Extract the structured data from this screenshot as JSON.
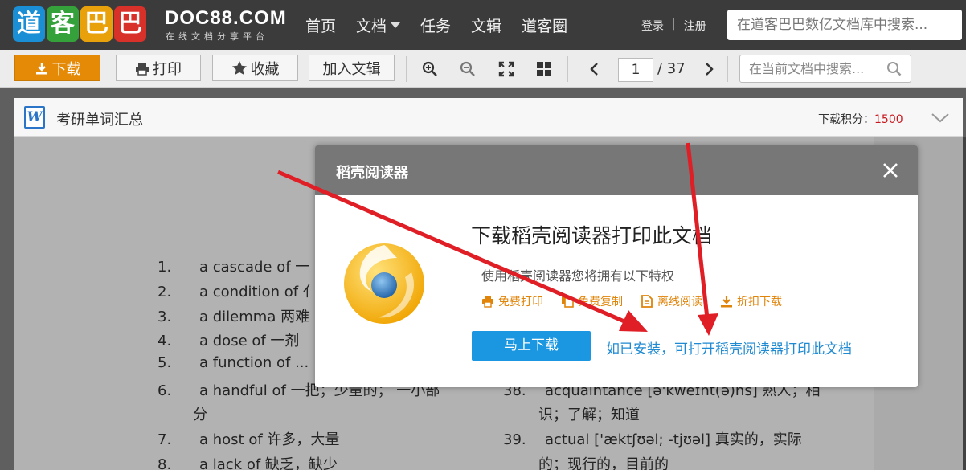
{
  "header": {
    "logo_chars": [
      "道",
      "客",
      "巴",
      "巴"
    ],
    "logo_colors": [
      "#1a8fd6",
      "#34a13b",
      "#e8a10b",
      "#d8312a"
    ],
    "site_name": "DOC88.COM",
    "site_tagline": "在线文档分享平台",
    "nav": [
      {
        "label": "首页",
        "has_dropdown": false
      },
      {
        "label": "文档",
        "has_dropdown": true
      },
      {
        "label": "任务",
        "has_dropdown": false
      },
      {
        "label": "文辑",
        "has_dropdown": false
      },
      {
        "label": "道客圈",
        "has_dropdown": false
      }
    ],
    "login": "登录",
    "auth_sep": "|",
    "register": "注册",
    "search_placeholder": "在道客巴巴数亿文档库中搜索..."
  },
  "toolbar": {
    "download": "下载",
    "print": "打印",
    "favorite": "收藏",
    "add_to_collection": "加入文辑",
    "zoom_in_icon": "zoom-in-icon",
    "zoom_out_icon": "zoom-out-icon",
    "fullscreen_icon": "fullscreen-icon",
    "grid_icon": "grid-view-icon",
    "current_page": "1",
    "total_pages": "/ 37",
    "doc_search_placeholder": "在当前文档中搜索..."
  },
  "document": {
    "title": "考研单词汇总",
    "points_label": "下载积分：",
    "points_value": "1500",
    "left_column": [
      {
        "n": "1.",
        "text": "a cascade of   一"
      },
      {
        "n": "2.",
        "text": "a condition of   ⺅"
      },
      {
        "n": "3.",
        "text": "a dilemma   两难"
      },
      {
        "n": "4.",
        "text": "a dose of   一剂"
      },
      {
        "n": "5.",
        "text": "a function of   ..."
      },
      {
        "n": "6.",
        "text": "a  handful  of   一把；少量的；   一小部"
      },
      {
        "n": "",
        "text": "分"
      },
      {
        "n": "7.",
        "text": "a host of   许多，大量"
      },
      {
        "n": "8.",
        "text": "a lack of   缺乏，缺少"
      }
    ],
    "right_column": [
      {
        "n": "38.",
        "text": "acquaintance [ə'kweɪnt(ə)ns]   熟人；相"
      },
      {
        "n": "",
        "text": "识；了解；知道"
      },
      {
        "n": "39.",
        "text": "actual  ['æktʃʊəl; -tjʊəl]   真实的，实际"
      },
      {
        "n": "",
        "text": "的；现行的，目前的"
      }
    ]
  },
  "modal": {
    "title": "稻壳阅读器",
    "heading": "下载稻壳阅读器打印此文档",
    "subheading": "使用稻壳阅读器您将拥有以下特权",
    "features": [
      "免费打印",
      "免费复制",
      "离线阅读",
      "折扣下载"
    ],
    "download_button": "马上下载",
    "open_link": "如已安装，可打开稻壳阅读器打印此文档"
  },
  "colors": {
    "accent_orange": "#e48a07",
    "link_blue": "#1f8ad1",
    "button_blue": "#1a97e0",
    "annotation_red": "#e01e26",
    "points_red": "#c8161d"
  }
}
